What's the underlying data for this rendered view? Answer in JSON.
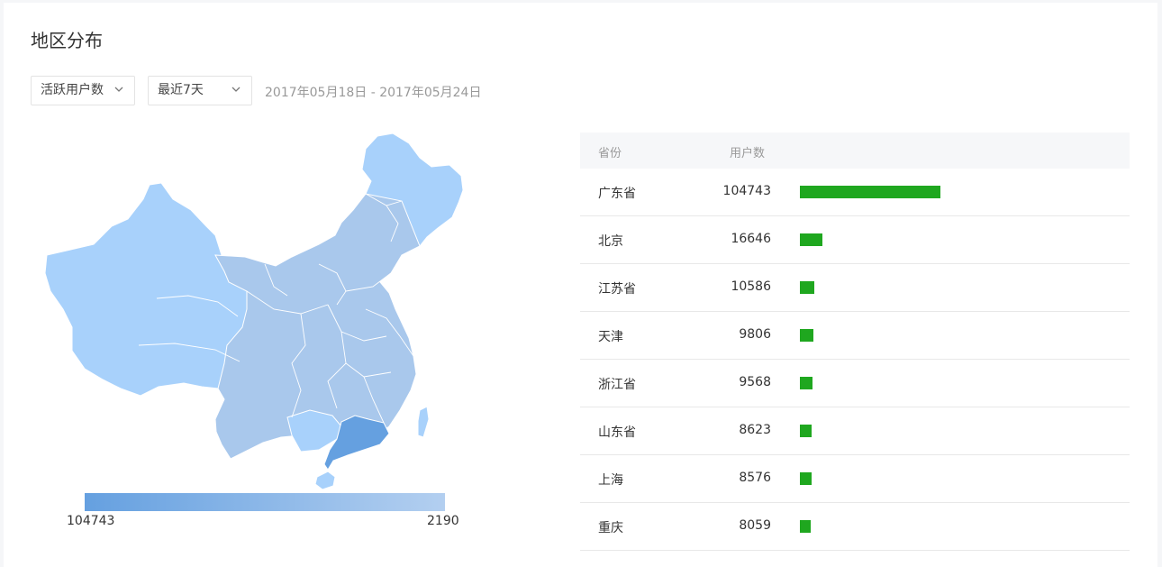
{
  "title": "地区分布",
  "filters": {
    "metric": "活跃用户数",
    "range": "最近7天",
    "date_range": "2017年05月18日 - 2017年05月24日"
  },
  "map": {
    "legend_min": "104743",
    "legend_max": "2190",
    "colors": {
      "low": "#a8d1fb",
      "mid": "#a9c8ec",
      "high": "#65a0e0"
    },
    "highlight": "广东省"
  },
  "table": {
    "headers": {
      "province": "省份",
      "users": "用户数"
    },
    "bar_color": "#1fa71f",
    "rows": [
      {
        "province": "广东省",
        "users": "104743",
        "value": 104743
      },
      {
        "province": "北京",
        "users": "16646",
        "value": 16646
      },
      {
        "province": "江苏省",
        "users": "10586",
        "value": 10586
      },
      {
        "province": "天津",
        "users": "9806",
        "value": 9806
      },
      {
        "province": "浙江省",
        "users": "9568",
        "value": 9568
      },
      {
        "province": "山东省",
        "users": "8623",
        "value": 8623
      },
      {
        "province": "上海",
        "users": "8576",
        "value": 8576
      },
      {
        "province": "重庆",
        "users": "8059",
        "value": 8059
      }
    ]
  }
}
